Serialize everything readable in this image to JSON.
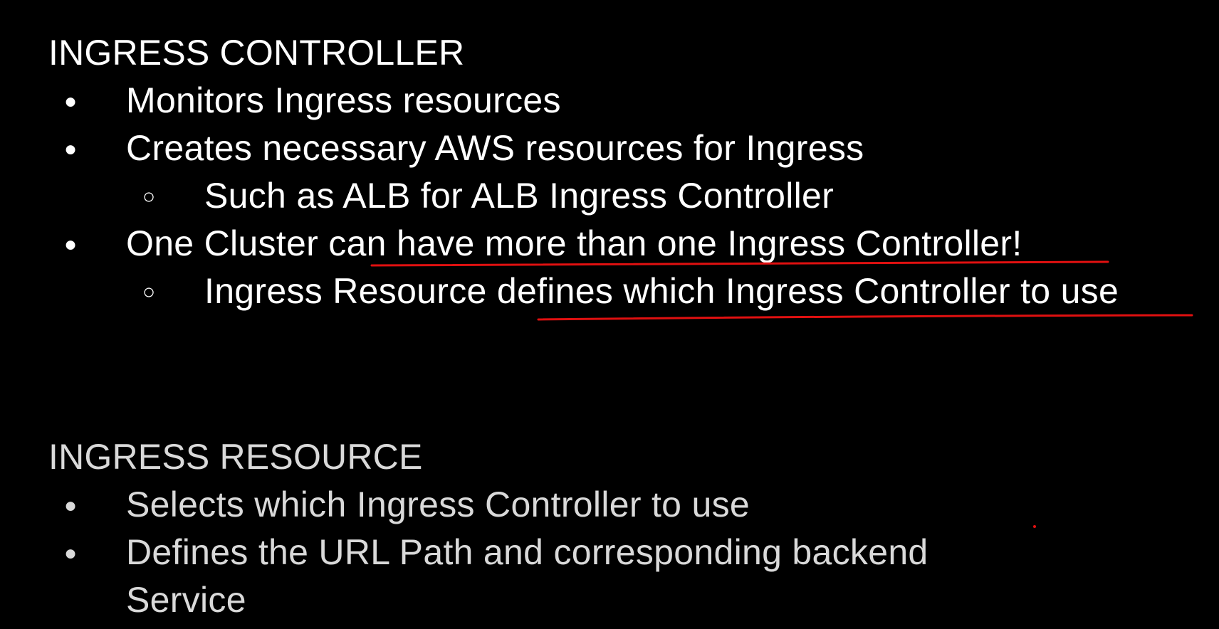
{
  "colors": {
    "background": "#000000",
    "text_primary": "#ffffff",
    "text_secondary": "#d9d9d9",
    "annotation": "#e01010"
  },
  "section_controller": {
    "heading": "INGRESS CONTROLLER",
    "bullet_1": "Monitors Ingress resources",
    "bullet_2": "Creates necessary AWS resources for Ingress",
    "sub_bullet_2a": "Such as ALB for ALB Ingress Controller",
    "bullet_3": "One Cluster can have more than one Ingress Controller!",
    "sub_bullet_3a": "Ingress Resource defines which Ingress Controller to use"
  },
  "section_resource": {
    "heading": "INGRESS RESOURCE",
    "bullet_1": "Selects which Ingress Controller to use",
    "bullet_2_line_1": "Defines the URL Path and corresponding backend",
    "bullet_2_line_2": "Service"
  },
  "glyphs": {
    "bullet": "●",
    "sub_bullet": "○"
  }
}
